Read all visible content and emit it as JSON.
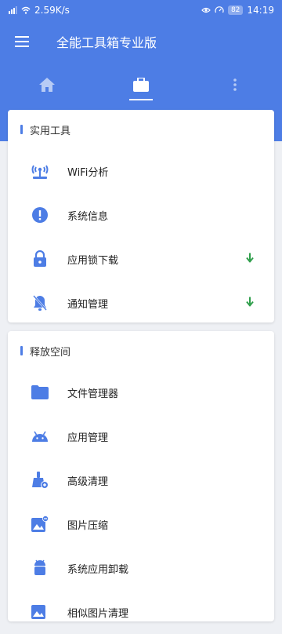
{
  "status_bar": {
    "speed": "2.59K/s",
    "battery": "82",
    "time": "14:19"
  },
  "app_bar": {
    "title": "全能工具箱专业版"
  },
  "tabs": [
    {
      "icon": "home-icon"
    },
    {
      "icon": "toolbox-icon",
      "selected": true
    },
    {
      "icon": "more-vertical-icon"
    }
  ],
  "cards": [
    {
      "title": "实用工具",
      "items": [
        {
          "label": "WiFi分析",
          "icon": "wifi-router-icon"
        },
        {
          "label": "系统信息",
          "icon": "info-alert-icon"
        },
        {
          "label": "应用锁下载",
          "icon": "lock-icon",
          "download": true
        },
        {
          "label": "通知管理",
          "icon": "bell-off-icon",
          "download": true
        }
      ]
    },
    {
      "title": "释放空间",
      "items": [
        {
          "label": "文件管理器",
          "icon": "folder-icon"
        },
        {
          "label": "应用管理",
          "icon": "android-icon"
        },
        {
          "label": "高级清理",
          "icon": "broom-icon"
        },
        {
          "label": "图片压缩",
          "icon": "image-compress-icon"
        },
        {
          "label": "系统应用卸载",
          "icon": "android-uninstall-icon"
        },
        {
          "label": "相似图片清理",
          "icon": "similar-image-icon"
        }
      ]
    }
  ],
  "colors": {
    "primary": "#4d7de5",
    "download": "#2e9e4a"
  }
}
